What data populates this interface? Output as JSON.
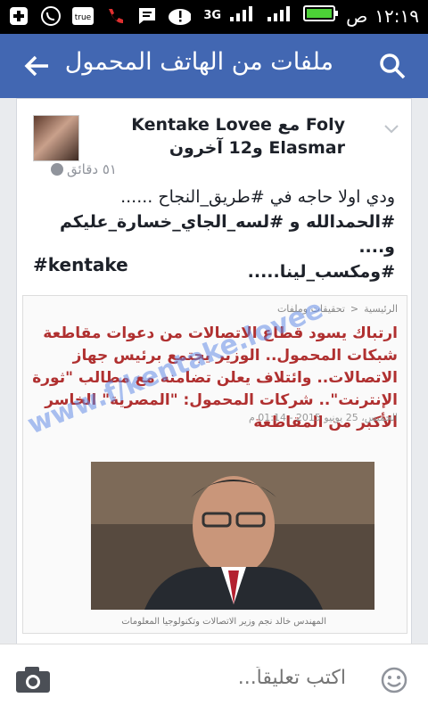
{
  "statusbar": {
    "time": "١٢:١٩",
    "ampm": "ص",
    "network": "3G",
    "icons": [
      "add-icon",
      "whatsapp-icon",
      "true-icon",
      "missed-call-icon",
      "message-icon",
      "alert-icon"
    ],
    "true_label": "true"
  },
  "appbar": {
    "title": "ملفات من الهاتف المحمول"
  },
  "post": {
    "author_line1": "Foly مع Kentake Lovee",
    "author_line2": "Elasmar و12 آخرون",
    "time_ago": "٥١ دقائق",
    "text_line1": "ودي اولا حاجه في #طريق_النجاح ......",
    "text_line2": "#الحمدالله و #لسه_الجاي_خسارة_عليكم و....",
    "text_line3": "#ومكسب_لينا.....",
    "hashtag": "#kentake"
  },
  "article": {
    "breadcrumb_home": "الرئيسية",
    "breadcrumb_section": "تحقيقات وملفات",
    "headline": "ارتباك يسود قطاع الاتصالات من دعوات مقاطعة شبكات المحمول.. الوزير يجتمع برئيس جهاز الاتصالات.. وائتلاف يعلن تضامنه مع مطالب \"ثورة الإنترنت\".. شركات المحمول: \"المصرية\" الخاسر الأكبر من المقاطعة",
    "date": "الخميس، 25 يونيو 2015 - 01:14 م",
    "caption": "المهندس خالد نجم وزير الاتصالات وتكنولوجيا المعلومات",
    "watermark": "www.f/kentake.lovee"
  },
  "composer": {
    "placeholder": "اكتب تعليقاً..."
  },
  "colors": {
    "appbar": "#4267b2",
    "headline": "#b03030",
    "battery": "#4cd137"
  }
}
